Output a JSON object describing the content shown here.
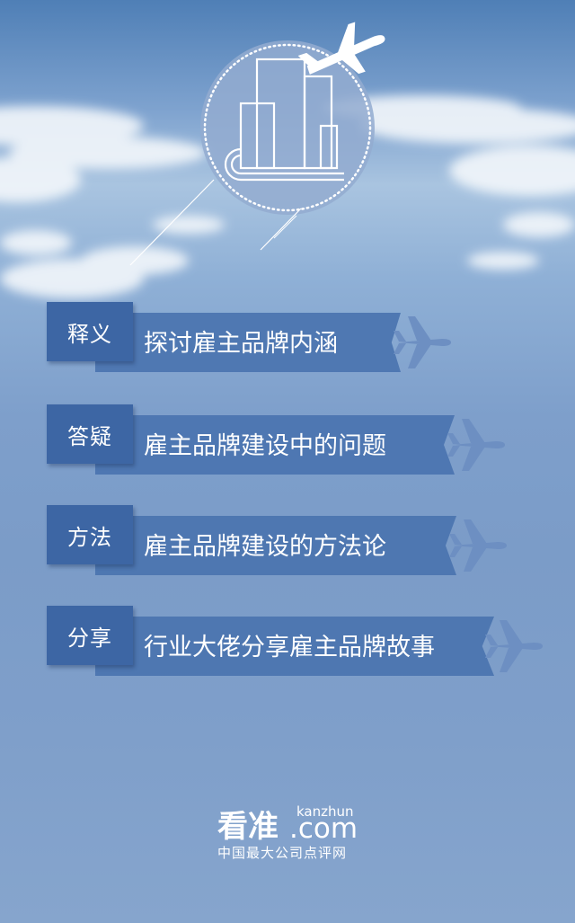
{
  "rows": [
    {
      "tag": "释义",
      "text": "探讨雇主品牌内涵"
    },
    {
      "tag": "答疑",
      "text": "雇主品牌建设中的问题"
    },
    {
      "tag": "方法",
      "text": "雇主品牌建设的方法论"
    },
    {
      "tag": "分享",
      "text": "行业大佬分享雇主品牌故事"
    }
  ],
  "logo": {
    "main": "看准",
    "latin": "kanzhun",
    "domain": ".com",
    "slogan": "中国最大公司点评网"
  },
  "colors": {
    "tag": "#3d66a4",
    "bar": "#4c75b0",
    "sky": "#7b9cc8"
  }
}
